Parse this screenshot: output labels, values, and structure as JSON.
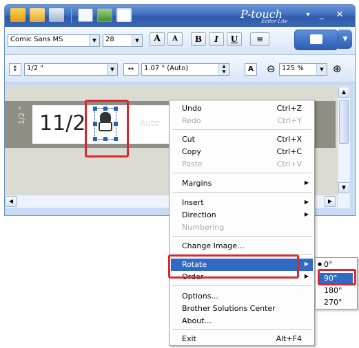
{
  "app": {
    "brand": "P-touch",
    "brand_sub": "Editor Lite",
    "min_glyph": "_",
    "close_glyph": "✕",
    "dropdown_glyph": "▾"
  },
  "toolbar": {
    "font_name": "Comic Sans MS",
    "font_size": "28",
    "grow_font_label": "A",
    "shrink_font_label": "A",
    "bold_label": "B",
    "italic_label": "I",
    "underline_label": "U",
    "tape_width": "1/2 \"",
    "label_length": "1.07 \" (Auto)",
    "zoom": "125 %",
    "zoom_out_glyph": "⊖",
    "zoom_in_glyph": "⊕",
    "align_glyph": "≡"
  },
  "canvas": {
    "label_text": "11/2",
    "side_label": "1/2 \"",
    "auto_text": "Auto"
  },
  "context_menu": {
    "items": [
      {
        "label": "Undo",
        "shortcut": "Ctrl+Z",
        "disabled": false
      },
      {
        "label": "Redo",
        "shortcut": "Ctrl+Y",
        "disabled": true
      },
      {
        "label": "Cut",
        "shortcut": "Ctrl+X",
        "disabled": false
      },
      {
        "label": "Copy",
        "shortcut": "Ctrl+C",
        "disabled": false
      },
      {
        "label": "Paste",
        "shortcut": "Ctrl+V",
        "disabled": true
      },
      {
        "label": "Margins",
        "shortcut": "",
        "disabled": false,
        "submenu": true
      },
      {
        "label": "Insert",
        "shortcut": "",
        "disabled": false,
        "submenu": true
      },
      {
        "label": "Direction",
        "shortcut": "",
        "disabled": false,
        "submenu": true
      },
      {
        "label": "Numbering",
        "shortcut": "",
        "disabled": true
      },
      {
        "label": "Change Image...",
        "shortcut": "",
        "disabled": false
      },
      {
        "label": "Rotate",
        "shortcut": "",
        "disabled": false,
        "submenu": true,
        "selected": true
      },
      {
        "label": "Order",
        "shortcut": "",
        "disabled": false,
        "submenu": true
      },
      {
        "label": "Options...",
        "shortcut": "",
        "disabled": false
      },
      {
        "label": "Brother Solutions Center",
        "shortcut": "",
        "disabled": false
      },
      {
        "label": "About...",
        "shortcut": "",
        "disabled": false
      },
      {
        "label": "Exit",
        "shortcut": "Alt+F4",
        "disabled": false
      }
    ],
    "submenu_arrow": "▶"
  },
  "rotate_submenu": {
    "options": [
      "0°",
      "90°",
      "180°",
      "270°"
    ],
    "checked": "0°",
    "highlighted": "90°",
    "check_glyph": "●"
  },
  "colors": {
    "highlight": "#d9272e",
    "menu_selected": "#3169c6",
    "titlebar": "#3f6fbf"
  }
}
